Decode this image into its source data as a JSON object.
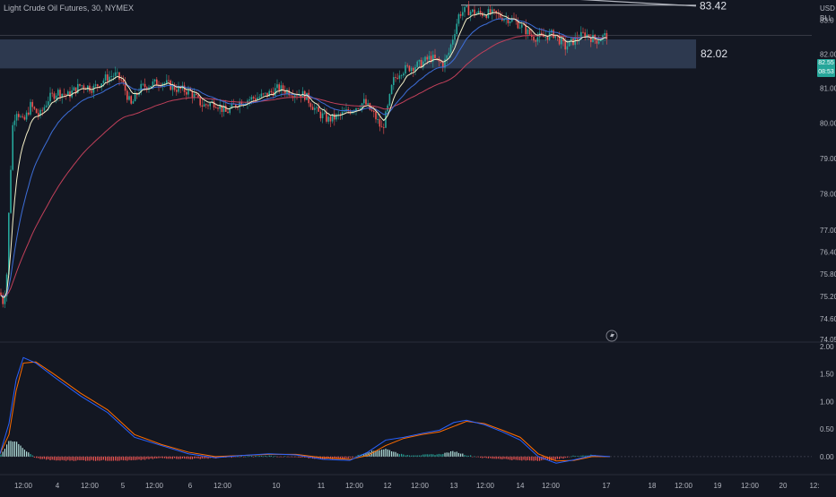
{
  "chart": {
    "symbol_line": "Light Crude Oil Futures, 30, NYMEX",
    "currency": "USD",
    "unit": "BLL",
    "last_price": "82.55",
    "countdown": "08:53",
    "colors": {
      "background": "#131722",
      "bull": "#26a69a",
      "bear": "#ef5350",
      "ema_fast": "#f5f0c8",
      "ema_mid": "#3d6ed8",
      "ema_slow": "#c2405a",
      "zone": "#2e3b52",
      "macd": "#2962ff",
      "signal": "#ff6d00",
      "trendline": "#b2b5be"
    },
    "icons": [
      "lightning-icon"
    ]
  },
  "chart_data": [
    {
      "type": "candlestick",
      "title": "Light Crude Oil Futures, 30, NYMEX",
      "y_axis_ticks": [
        "83.0",
        "82.00",
        "81.00",
        "80.00",
        "79.00",
        "78.00",
        "77.00",
        "76.40",
        "75.80",
        "75.20",
        "74.60",
        "74.05"
      ],
      "x_axis_ticks": [
        "12:00",
        "4",
        "12:00",
        "5",
        "12:00",
        "6",
        "12:00",
        "10",
        "11",
        "12:00",
        "12",
        "12:00",
        "13",
        "12:00",
        "14",
        "12:00",
        "17",
        "18",
        "12:00",
        "19",
        "12:00",
        "20",
        "12:"
      ],
      "y_scale": "log",
      "ylim": [
        74.0,
        83.6
      ],
      "annotations": [
        {
          "text": "83.42",
          "value": 83.42
        },
        {
          "text": "82.02",
          "value": 82.02,
          "zone": [
            81.58,
            82.43
          ]
        }
      ],
      "price_path": [
        [
          0,
          75.3
        ],
        [
          4,
          75.0
        ],
        [
          8,
          75.9
        ],
        [
          10,
          77.6
        ],
        [
          14,
          79.9
        ],
        [
          18,
          80.4
        ],
        [
          26,
          80.0
        ],
        [
          34,
          80.5
        ],
        [
          44,
          80.2
        ],
        [
          54,
          80.7
        ],
        [
          64,
          80.9
        ],
        [
          76,
          80.8
        ],
        [
          90,
          81.1
        ],
        [
          104,
          81.0
        ],
        [
          118,
          81.3
        ],
        [
          128,
          81.4
        ],
        [
          136,
          81.2
        ],
        [
          146,
          80.5
        ],
        [
          156,
          81.0
        ],
        [
          166,
          81.1
        ],
        [
          180,
          81.2
        ],
        [
          196,
          81.0
        ],
        [
          212,
          80.9
        ],
        [
          226,
          80.5
        ],
        [
          240,
          80.6
        ],
        [
          252,
          80.3
        ],
        [
          266,
          80.6
        ],
        [
          280,
          80.7
        ],
        [
          296,
          80.8
        ],
        [
          310,
          81.0
        ],
        [
          324,
          80.9
        ],
        [
          340,
          80.8
        ],
        [
          354,
          80.3
        ],
        [
          366,
          80.1
        ],
        [
          378,
          80.2
        ],
        [
          392,
          80.4
        ],
        [
          406,
          80.6
        ],
        [
          418,
          80.2
        ],
        [
          426,
          79.8
        ],
        [
          432,
          80.4
        ],
        [
          438,
          81.2
        ],
        [
          446,
          81.5
        ],
        [
          456,
          81.6
        ],
        [
          468,
          81.7
        ],
        [
          480,
          81.9
        ],
        [
          494,
          81.7
        ],
        [
          500,
          82.0
        ],
        [
          506,
          82.6
        ],
        [
          512,
          83.2
        ],
        [
          520,
          83.3
        ],
        [
          532,
          83.2
        ],
        [
          546,
          83.2
        ],
        [
          560,
          83.1
        ],
        [
          572,
          83.0
        ],
        [
          582,
          82.8
        ],
        [
          594,
          82.5
        ],
        [
          606,
          82.5
        ],
        [
          618,
          82.6
        ],
        [
          630,
          82.2
        ],
        [
          640,
          82.4
        ],
        [
          652,
          82.6
        ],
        [
          664,
          82.4
        ],
        [
          676,
          82.55
        ]
      ],
      "trendline": {
        "from": [
          0,
          84.6
        ],
        "to": [
          776,
          83.42
        ]
      }
    },
    {
      "type": "line",
      "title": "MACD",
      "y_axis_ticks": [
        "2.00",
        "1.50",
        "1.00",
        "0.50",
        "0.00"
      ],
      "ylim": [
        -0.1,
        2.0
      ],
      "series": [
        {
          "color": "#2962ff",
          "x": [
            0,
            10,
            18,
            26,
            40,
            60,
            90,
            120,
            150,
            180,
            210,
            240,
            270,
            300,
            330,
            360,
            390,
            410,
            430,
            450,
            470,
            490,
            506,
            520,
            540,
            560,
            580,
            600,
            620,
            640,
            660,
            680
          ],
          "y": [
            0.05,
            0.6,
            1.4,
            1.8,
            1.7,
            1.45,
            1.1,
            0.8,
            0.35,
            0.2,
            0.05,
            -0.02,
            0.02,
            0.05,
            0.03,
            -0.05,
            -0.07,
            0.08,
            0.3,
            0.35,
            0.42,
            0.48,
            0.62,
            0.66,
            0.58,
            0.45,
            0.3,
            0.0,
            -0.12,
            -0.06,
            0.02,
            0.0
          ]
        },
        {
          "color": "#ff6d00",
          "x": [
            0,
            10,
            18,
            26,
            40,
            60,
            90,
            120,
            150,
            180,
            210,
            240,
            270,
            300,
            330,
            360,
            390,
            410,
            430,
            450,
            470,
            490,
            506,
            520,
            540,
            560,
            580,
            600,
            620,
            640,
            660,
            680
          ],
          "y": [
            0.05,
            0.4,
            1.2,
            1.7,
            1.72,
            1.5,
            1.15,
            0.85,
            0.4,
            0.22,
            0.08,
            0.0,
            0.02,
            0.04,
            0.04,
            -0.02,
            -0.05,
            0.02,
            0.2,
            0.33,
            0.4,
            0.45,
            0.55,
            0.64,
            0.6,
            0.48,
            0.35,
            0.05,
            -0.08,
            -0.07,
            0.0,
            0.0
          ]
        }
      ]
    }
  ]
}
